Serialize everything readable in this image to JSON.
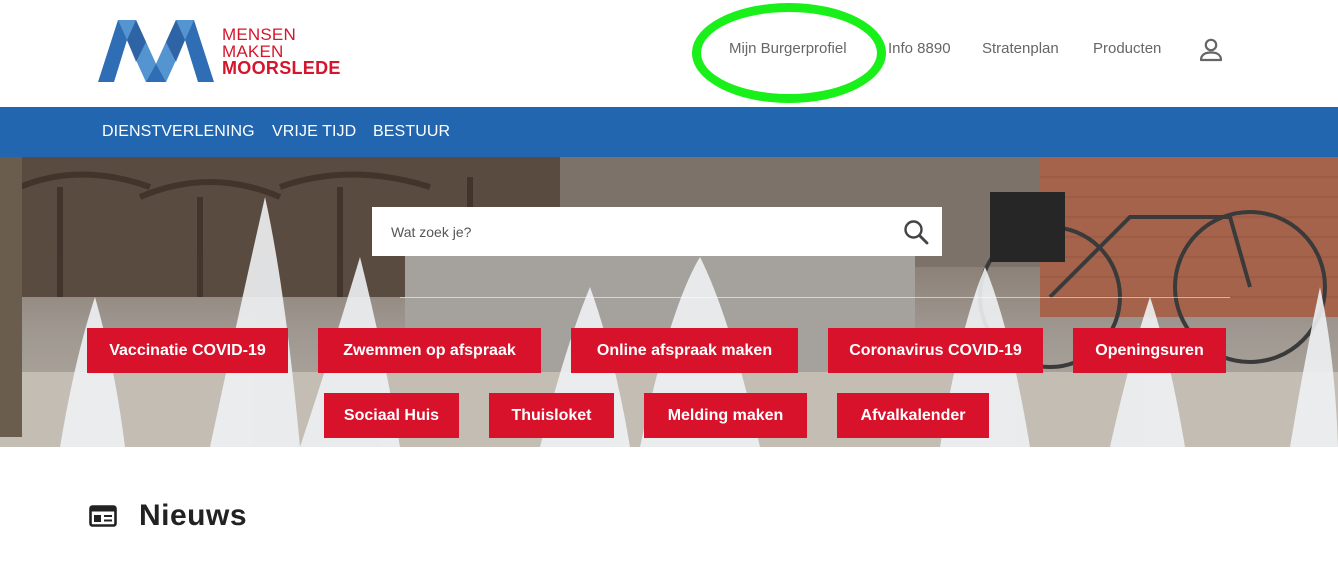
{
  "logo": {
    "line1": "MENSEN",
    "line2": "MAKEN",
    "line3": "MOORSLEDE",
    "colors": {
      "blue": "#2f6db5",
      "light_blue": "#5b9bd5",
      "red": "#d4152b"
    }
  },
  "topnav": {
    "items": [
      {
        "label": "Mijn Burgerprofiel"
      },
      {
        "label": "Info 8890"
      },
      {
        "label": "Stratenplan"
      },
      {
        "label": "Producten"
      }
    ],
    "user_icon": "user-icon"
  },
  "mainnav": {
    "items": [
      {
        "label": "DIENSTVERLENING"
      },
      {
        "label": "VRIJE TIJD"
      },
      {
        "label": "BESTUUR"
      }
    ],
    "background": "#2166ae"
  },
  "search": {
    "placeholder": "Wat zoek je?",
    "icon": "search-icon"
  },
  "quicklinks": {
    "row1": [
      {
        "label": "Vaccinatie COVID-19"
      },
      {
        "label": "Zwemmen op afspraak"
      },
      {
        "label": "Online afspraak maken"
      },
      {
        "label": "Coronavirus COVID-19"
      },
      {
        "label": "Openingsuren"
      }
    ],
    "row2": [
      {
        "label": "Sociaal Huis"
      },
      {
        "label": "Thuisloket"
      },
      {
        "label": "Melding maken"
      },
      {
        "label": "Afvalkalender"
      }
    ],
    "button_color": "#d8122b"
  },
  "news": {
    "title": "Nieuws",
    "icon": "newspaper-icon"
  },
  "annotation": {
    "highlight_color": "#19ef19"
  }
}
